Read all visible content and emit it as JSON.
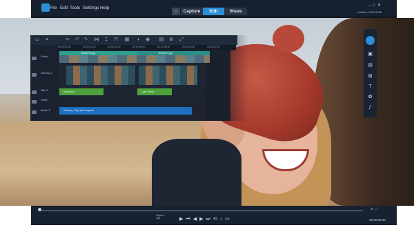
{
  "menu": {
    "file": "File",
    "edit": "Edit",
    "tools": "Tools",
    "settings": "Settings",
    "help": "Help"
  },
  "tabs": [
    {
      "label": "Capture"
    },
    {
      "label": "Edit"
    },
    {
      "label": "Share"
    }
  ],
  "home_icon": "home-icon",
  "project_status": "Untitled, 1920*1080",
  "ruler_times": [
    "00:00:00:00",
    "00:00:02:00",
    "00:00:04:00",
    "00:00:06:00",
    "00:00:08:00",
    "00:00:10:00",
    "00:00:12:00",
    "00:00:14:00"
  ],
  "tracks": [
    {
      "label": "Video"
    },
    {
      "label": "Overlay 1"
    },
    {
      "label": "Title 1"
    },
    {
      "label": "Voice"
    },
    {
      "label": "Music 1"
    }
  ],
  "clips": {
    "video_1": "BN0CFH.jpg",
    "video_2": "BN0DFH.jpg",
    "title_1": "Adventure",
    "title_2": "Lake Placid",
    "music_1": "Trekking - Big Hip Escapade"
  },
  "player": {
    "project_label": "Project~",
    "clip_label": "Clip~",
    "timecode": "00:00:00:00",
    "progress": 0
  },
  "accent_color": "#2b8fd8"
}
